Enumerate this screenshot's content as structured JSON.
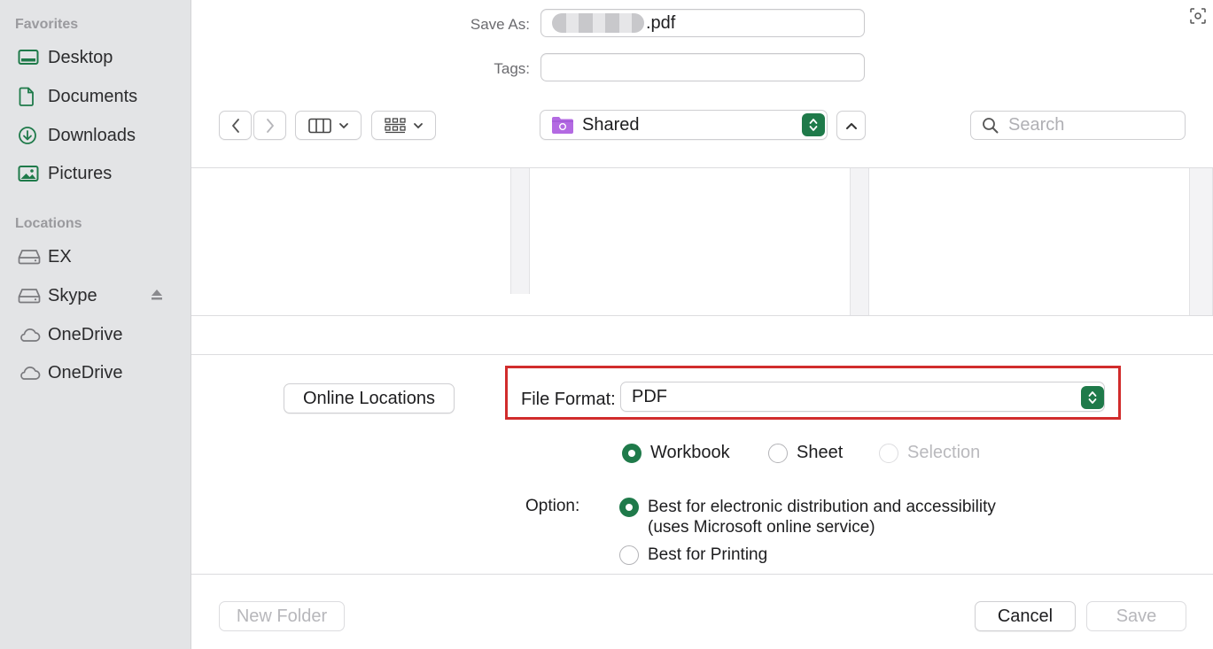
{
  "sidebar": {
    "favorites_header": "Favorites",
    "favorites": [
      {
        "label": "Desktop",
        "icon": "desktop-icon"
      },
      {
        "label": "Documents",
        "icon": "document-icon"
      },
      {
        "label": "Downloads",
        "icon": "download-icon"
      },
      {
        "label": "Pictures",
        "icon": "pictures-icon"
      }
    ],
    "locations_header": "Locations",
    "locations": [
      {
        "label": "EX",
        "icon": "drive-icon"
      },
      {
        "label": "Skype",
        "icon": "drive-icon"
      },
      {
        "label": "OneDrive",
        "icon": "cloud-icon"
      },
      {
        "label": "OneDrive",
        "icon": "cloud-icon"
      }
    ]
  },
  "save_as": {
    "label": "Save As:",
    "value": ".pdf"
  },
  "tags": {
    "label": "Tags:",
    "value": ""
  },
  "location": {
    "current": "Shared"
  },
  "search": {
    "placeholder": "Search"
  },
  "online_locations_label": "Online Locations",
  "file_format": {
    "label": "File Format:",
    "value": "PDF"
  },
  "scope": {
    "options": [
      "Workbook",
      "Sheet",
      "Selection"
    ],
    "selected": "Workbook"
  },
  "option": {
    "label": "Option:",
    "choices": [
      {
        "line1": "Best for electronic distribution and accessibility",
        "line2": "(uses Microsoft online service)"
      },
      {
        "line1": "Best for Printing",
        "line2": ""
      }
    ],
    "selected_index": 0
  },
  "footer": {
    "new_folder": "New Folder",
    "cancel": "Cancel",
    "save": "Save"
  },
  "colors": {
    "accent": "#1f7a4a",
    "highlight": "#d12c2c",
    "sidebar_bg": "#e3e4e6"
  }
}
